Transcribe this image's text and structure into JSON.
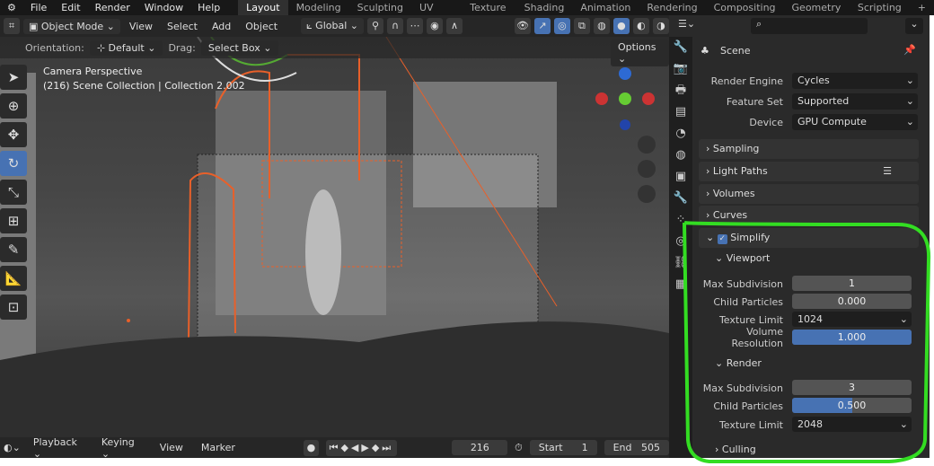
{
  "menu": [
    "File",
    "Edit",
    "Render",
    "Window",
    "Help"
  ],
  "workspaces": [
    "Layout",
    "Modeling",
    "Sculpting",
    "UV Editing",
    "Texture Paint",
    "Shading",
    "Animation",
    "Rendering",
    "Compositing",
    "Geometry Nodes",
    "Scripting",
    "+"
  ],
  "header": {
    "mode": "Object Mode",
    "view": "View",
    "select": "Select",
    "add": "Add",
    "object": "Object",
    "transform": "Global"
  },
  "orient": {
    "label": "Orientation:",
    "value": "Default",
    "drag_label": "Drag:",
    "drag_value": "Select Box",
    "options": "Options"
  },
  "overlay": {
    "line1": "Camera Perspective",
    "line2": "(216) Scene Collection | Collection 2.002"
  },
  "timeline": {
    "playback": "Playback",
    "keying": "Keying",
    "view": "View",
    "marker": "Marker",
    "frame": "216",
    "start_label": "Start",
    "start": "1",
    "end_label": "End",
    "end": "505"
  },
  "props": {
    "scene": "Scene",
    "render_engine_label": "Render Engine",
    "render_engine": "Cycles",
    "feature_set_label": "Feature Set",
    "feature_set": "Supported",
    "device_label": "Device",
    "device": "GPU Compute",
    "panels": [
      "Sampling",
      "Light Paths",
      "Volumes",
      "Curves"
    ],
    "simplify": "Simplify",
    "viewport": "Viewport",
    "vp": {
      "max_sub_label": "Max Subdivision",
      "max_sub": "1",
      "child_label": "Child Particles",
      "child": "0.000",
      "tex_label": "Texture Limit",
      "tex": "1024",
      "vol_label": "Volume Resolution",
      "vol": "1.000"
    },
    "render": "Render",
    "rd": {
      "max_sub_label": "Max Subdivision",
      "max_sub": "3",
      "child_label": "Child Particles",
      "child": "0.500",
      "tex_label": "Texture Limit",
      "tex": "2048"
    },
    "culling": "Culling",
    "fills": {
      "vol": 1.0,
      "child_render": 0.5
    }
  },
  "colors": {
    "accent": "#4772b3",
    "highlight": "#33dd22",
    "selection": "#e8602a"
  }
}
